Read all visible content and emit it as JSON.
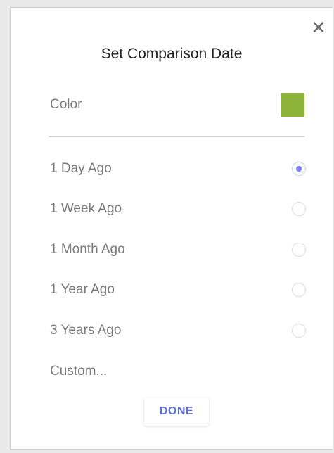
{
  "dialog": {
    "close_glyph": "✕",
    "title": "Set Comparison Date",
    "color_label": "Color",
    "color_value": "#8db33a",
    "options": [
      {
        "label": "1 Day Ago",
        "selected": true
      },
      {
        "label": "1 Week Ago",
        "selected": false
      },
      {
        "label": "1 Month Ago",
        "selected": false
      },
      {
        "label": "1 Year Ago",
        "selected": false
      },
      {
        "label": "3 Years Ago",
        "selected": false
      }
    ],
    "custom_label": "Custom...",
    "done_label": "DONE",
    "accent_color": "#5b6ee0",
    "radio_selected_color": "#7b7ff2"
  }
}
